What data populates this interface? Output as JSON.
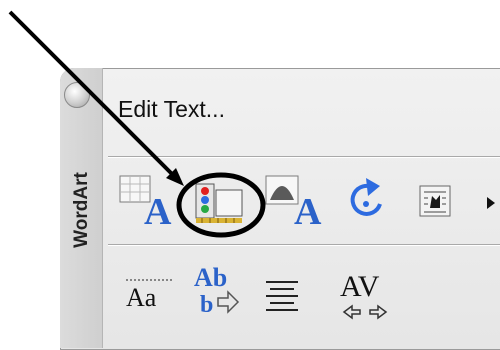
{
  "palette": {
    "title": "WordArt",
    "edit_text_label": "Edit Text...",
    "row1_icons": [
      "wordart-gallery-icon",
      "wordart-format-icon",
      "wordart-shape-icon",
      "free-rotate-icon",
      "text-wrapping-icon",
      "more-arrow-icon"
    ],
    "row2_icons": [
      "same-letter-heights-icon",
      "vertical-text-icon",
      "alignment-icon",
      "character-spacing-icon"
    ],
    "glyphs": {
      "letter_a": "A",
      "aa": "Aa",
      "ab_top": "Ab",
      "ab_bottom": "b",
      "av": "AV"
    }
  },
  "annotation": {
    "highlight_color": "#000000"
  }
}
